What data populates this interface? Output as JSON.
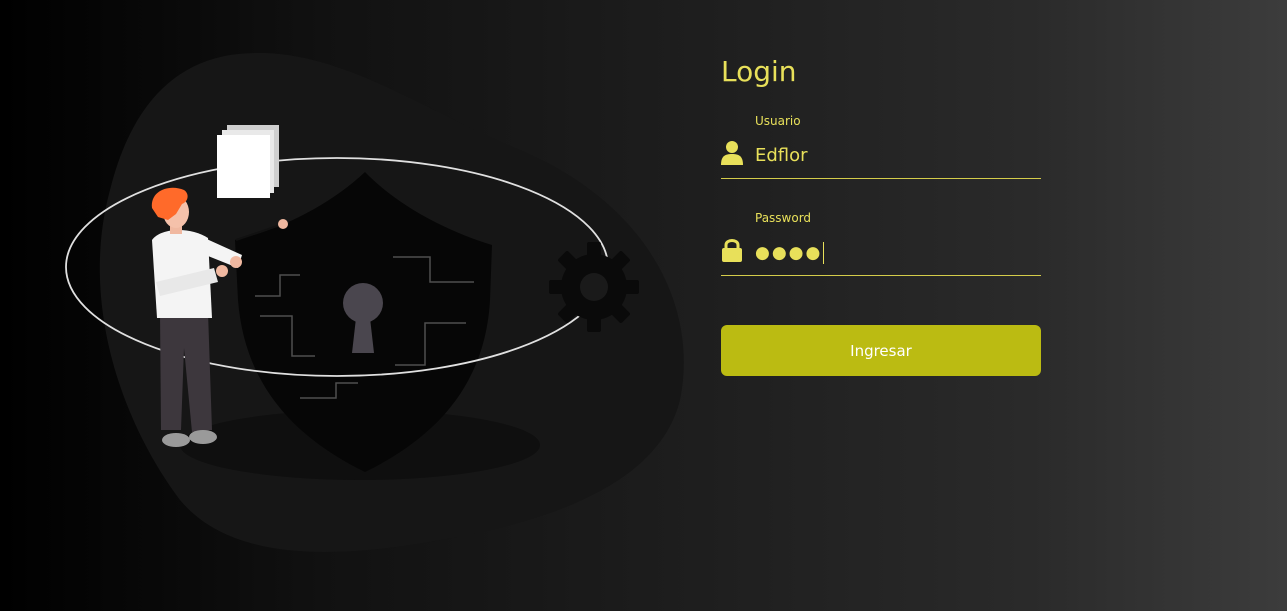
{
  "login": {
    "title": "Login",
    "username_label": "Usuario",
    "username_value": "Edflor",
    "password_label": "Password",
    "password_value": "●●●●",
    "submit_label": "Ingresar"
  },
  "icons": {
    "username": "user-icon",
    "password": "lock-icon"
  },
  "colors": {
    "accent": "#e8e05a",
    "button": "#bbbb12",
    "button_text": "#ffffff",
    "underline": "#d4cc4a"
  }
}
